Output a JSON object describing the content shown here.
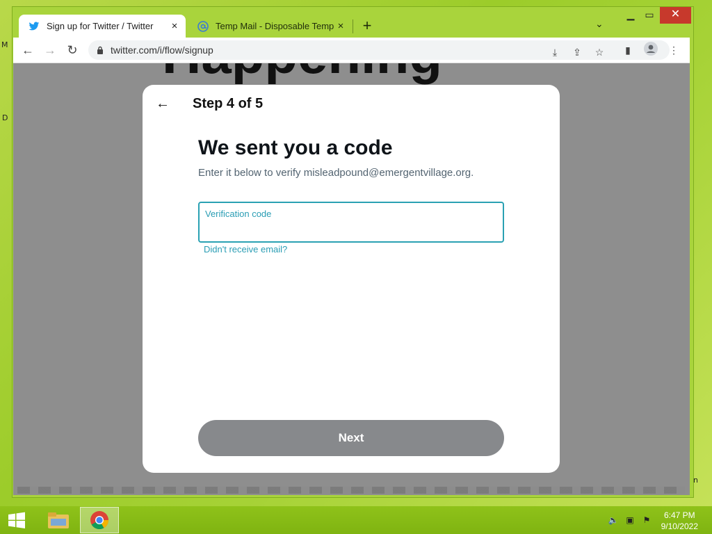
{
  "browser": {
    "tabs": [
      {
        "title": "Sign up for Twitter / Twitter",
        "active": true,
        "icon": "twitter-bird-icon"
      },
      {
        "title": "Temp Mail - Disposable Temporary",
        "active": false,
        "icon": "at-sign-icon"
      }
    ],
    "url": "twitter.com/i/flow/signup",
    "new_tab_glyph": "+",
    "close_glyph": "×"
  },
  "page": {
    "background_heading": "Happening",
    "modal": {
      "step": "Step 4 of 5",
      "heading": "We sent you a code",
      "subtext": "Enter it below to verify misleadpound@emergentvillage.org.",
      "field_label": "Verification code",
      "field_value": "",
      "resend_link": "Didn't receive email?",
      "next_button": "Next"
    }
  },
  "taskbar": {
    "time": "6:47 PM",
    "date": "9/10/2022"
  },
  "desktop": {
    "edge_letters": [
      "M",
      "D",
      "n"
    ]
  },
  "colors": {
    "accent": "#1d9bf0",
    "next_disabled": "#87898c",
    "desktop_green": "#a6d236",
    "close_red": "#c7392c"
  }
}
